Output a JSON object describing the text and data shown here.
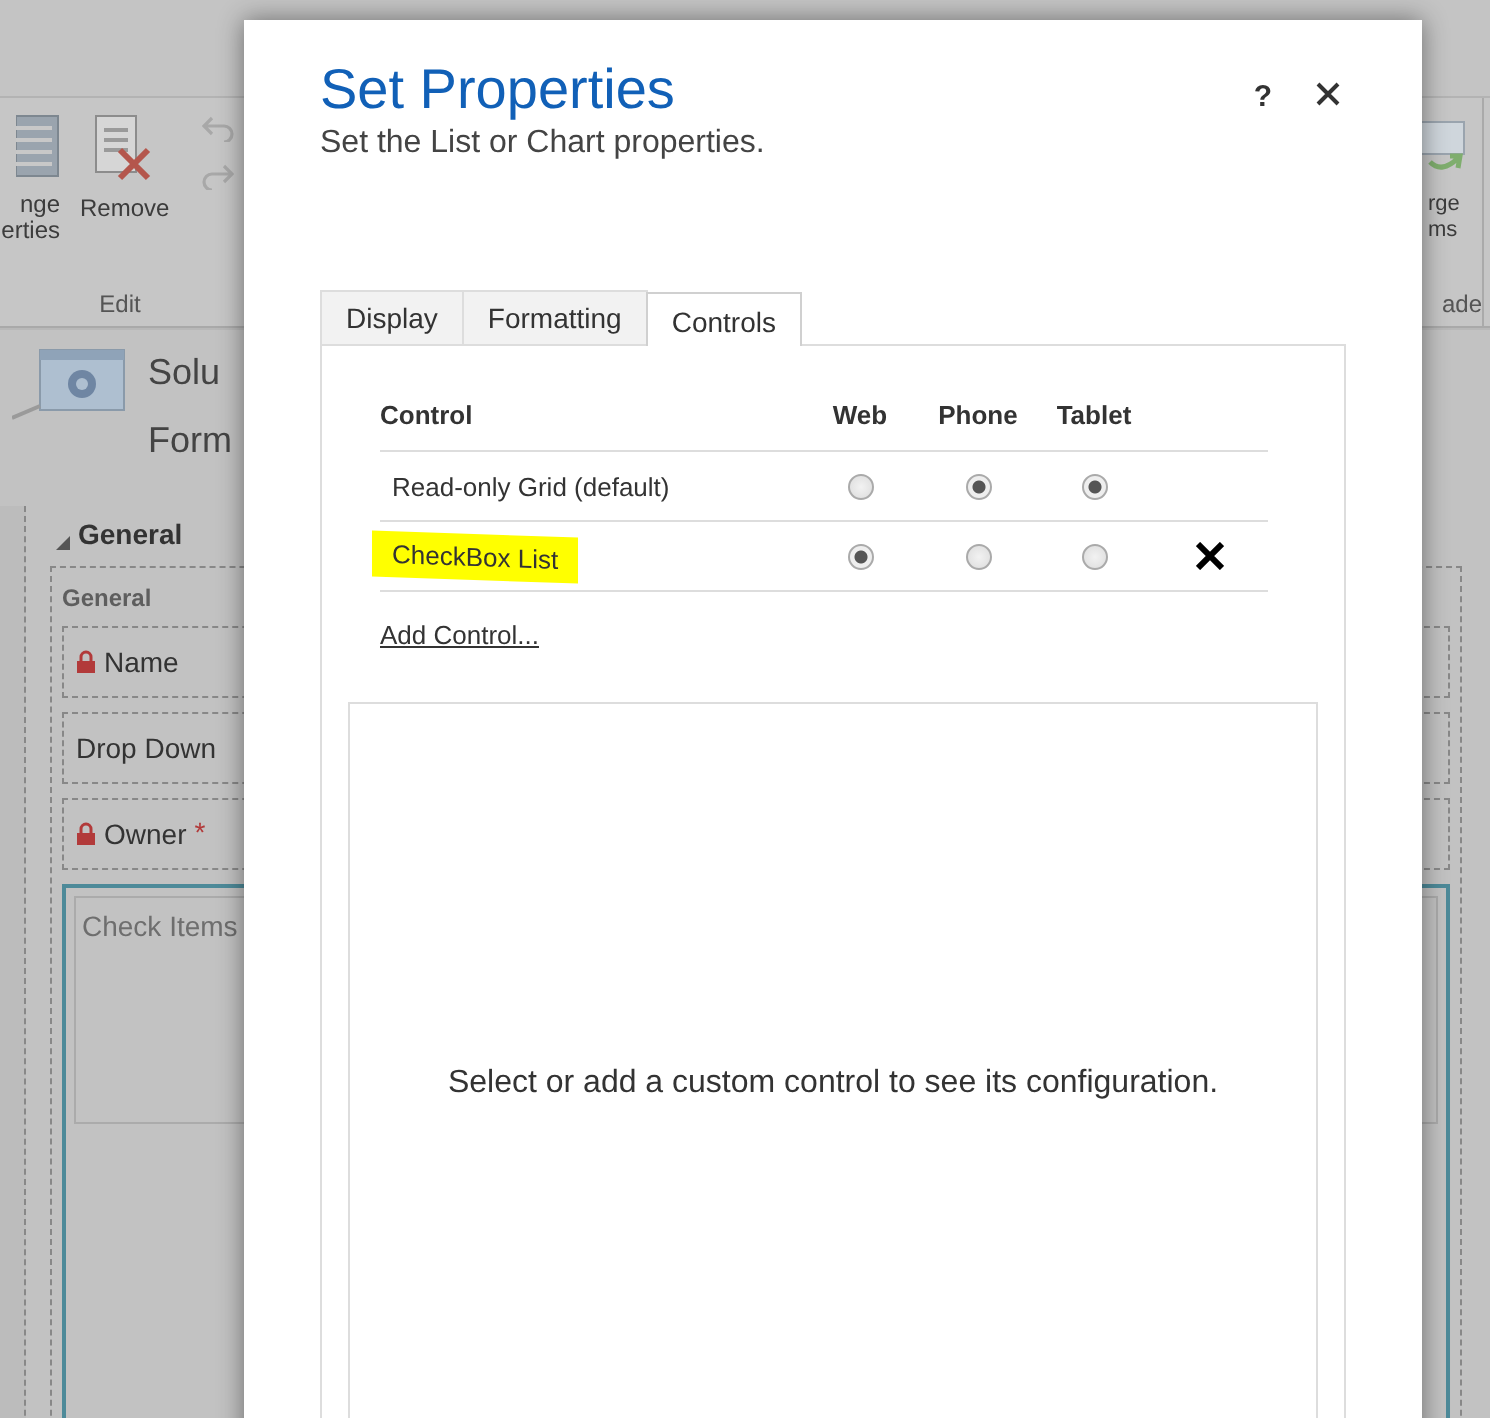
{
  "background": {
    "ribbon": {
      "left_button": {
        "label_lines": [
          "nge",
          "erties"
        ]
      },
      "remove_button": {
        "label": "Remove"
      },
      "group_label": "Edit",
      "right_button": {
        "label_lines": [
          "rge",
          "ms"
        ]
      },
      "right_group_label": "ade"
    },
    "header": {
      "line_1": "Solu",
      "line_2": "Form"
    },
    "section": {
      "title": "General",
      "label": "General",
      "fields": [
        {
          "label": "Name",
          "locked": true
        },
        {
          "label": "Drop Down",
          "locked": false
        },
        {
          "label": "Owner",
          "locked": true,
          "required_mark": "*"
        }
      ],
      "subgrid_placeholder": "Check Items"
    }
  },
  "dialog": {
    "title": "Set Properties",
    "subtitle": "Set the List or Chart properties.",
    "help": "?",
    "tabs": [
      {
        "label": "Display",
        "selected": false
      },
      {
        "label": "Formatting",
        "selected": false
      },
      {
        "label": "Controls",
        "selected": true
      }
    ],
    "columns": [
      "Control",
      "Web",
      "Phone",
      "Tablet"
    ],
    "rows": [
      {
        "name": "Read-only Grid (default)",
        "highlighted": false,
        "removable": false,
        "devices": [
          {
            "selected": false
          },
          {
            "selected": true
          },
          {
            "selected": true
          }
        ]
      },
      {
        "name": "CheckBox List",
        "highlighted": true,
        "removable": true,
        "devices": [
          {
            "selected": true
          },
          {
            "selected": false
          },
          {
            "selected": false
          }
        ]
      }
    ],
    "add_link": "Add Control...",
    "config_message": "Select or add a custom control to see its configuration."
  }
}
